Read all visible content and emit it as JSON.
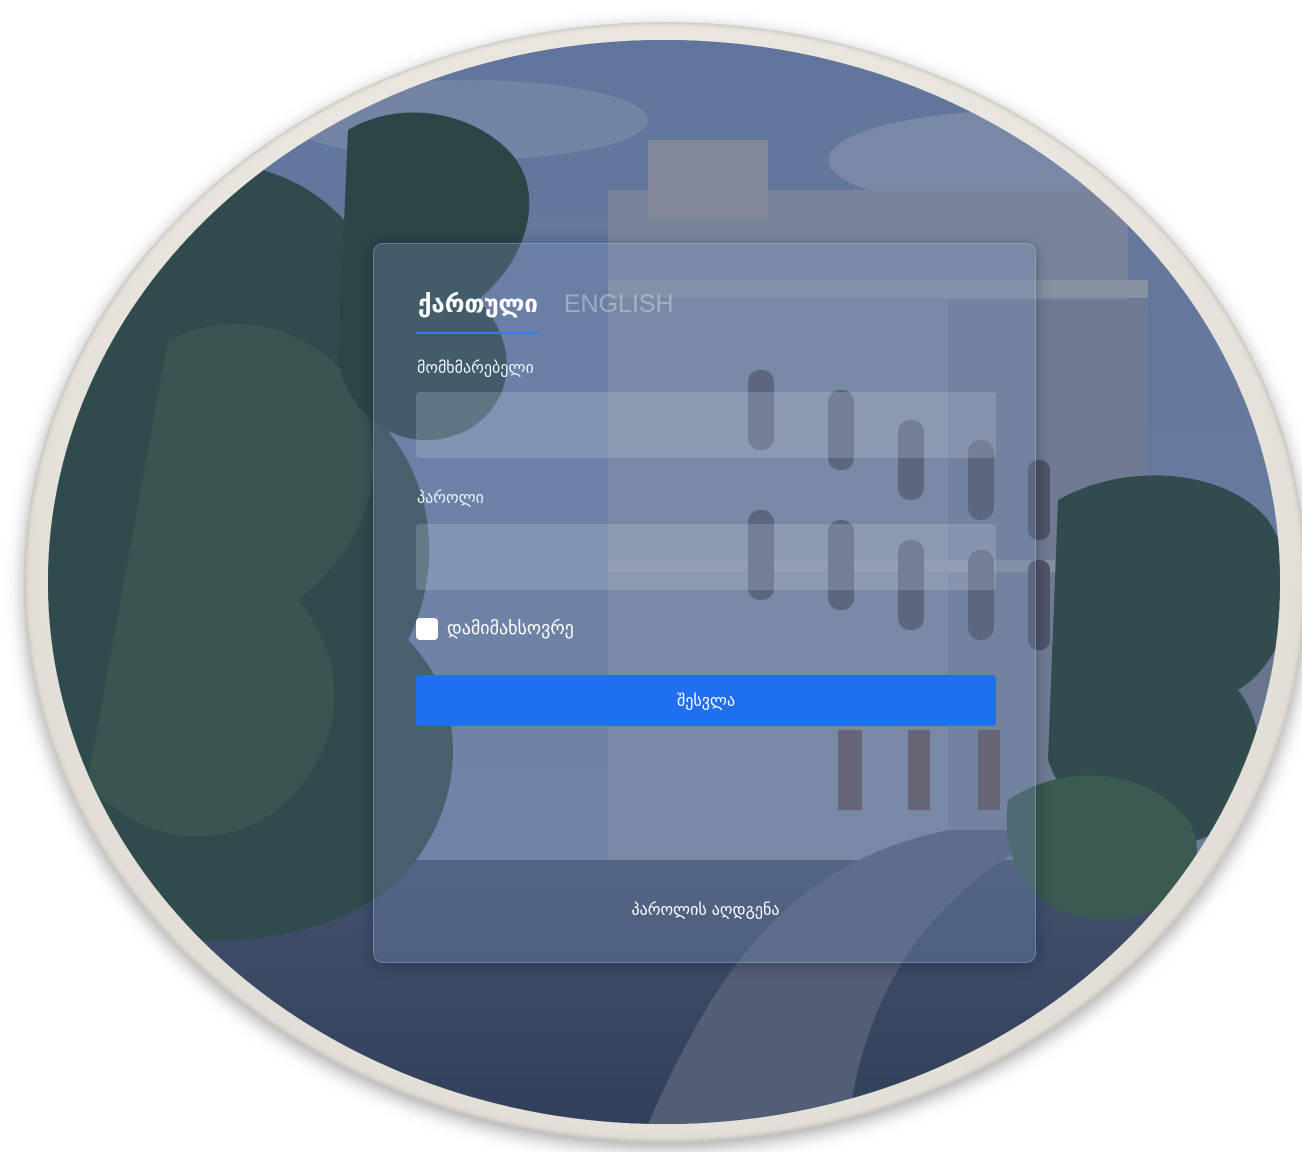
{
  "colors": {
    "accent": "#1f6ff2",
    "tab_underline": "#2f7bff",
    "panel_tint": "#7c92be"
  },
  "tabs": [
    {
      "label": "ქართული",
      "active": true
    },
    {
      "label": "ENGLISH",
      "active": false
    }
  ],
  "form": {
    "username_label": "მომხმარებელი",
    "username_value": "",
    "password_label": "პაროლი",
    "password_value": "",
    "remember_label": "დამიმახსოვრე",
    "remember_checked": false,
    "submit_label": "შესვლა",
    "recover_label": "პაროლის აღდგენა"
  }
}
